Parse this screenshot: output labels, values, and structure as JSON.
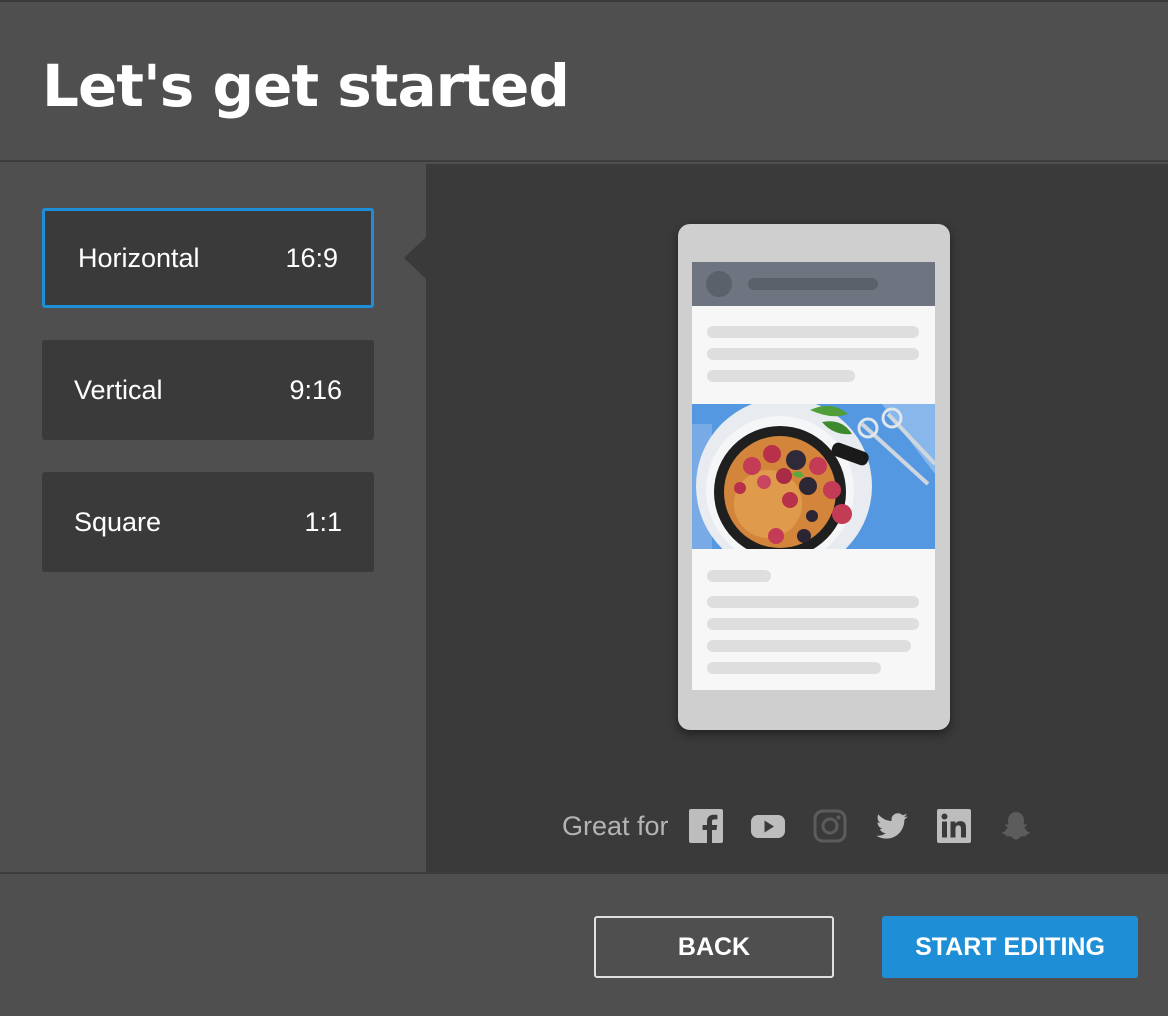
{
  "header": {
    "title": "Let's get started"
  },
  "options": [
    {
      "label": "Horizontal",
      "ratio": "16:9",
      "selected": true
    },
    {
      "label": "Vertical",
      "ratio": "9:16",
      "selected": false
    },
    {
      "label": "Square",
      "ratio": "1:1",
      "selected": false
    }
  ],
  "preview": {
    "great_for_label": "Great for",
    "platforms": [
      "facebook-icon",
      "youtube-icon",
      "instagram-icon",
      "twitter-icon",
      "linkedin-icon",
      "snapchat-icon"
    ]
  },
  "footer": {
    "back_label": "BACK",
    "start_label": "START EDITING"
  },
  "colors": {
    "accent": "#1e8fd6",
    "panel": "#3a3a3a",
    "background": "#4f4f4f"
  }
}
